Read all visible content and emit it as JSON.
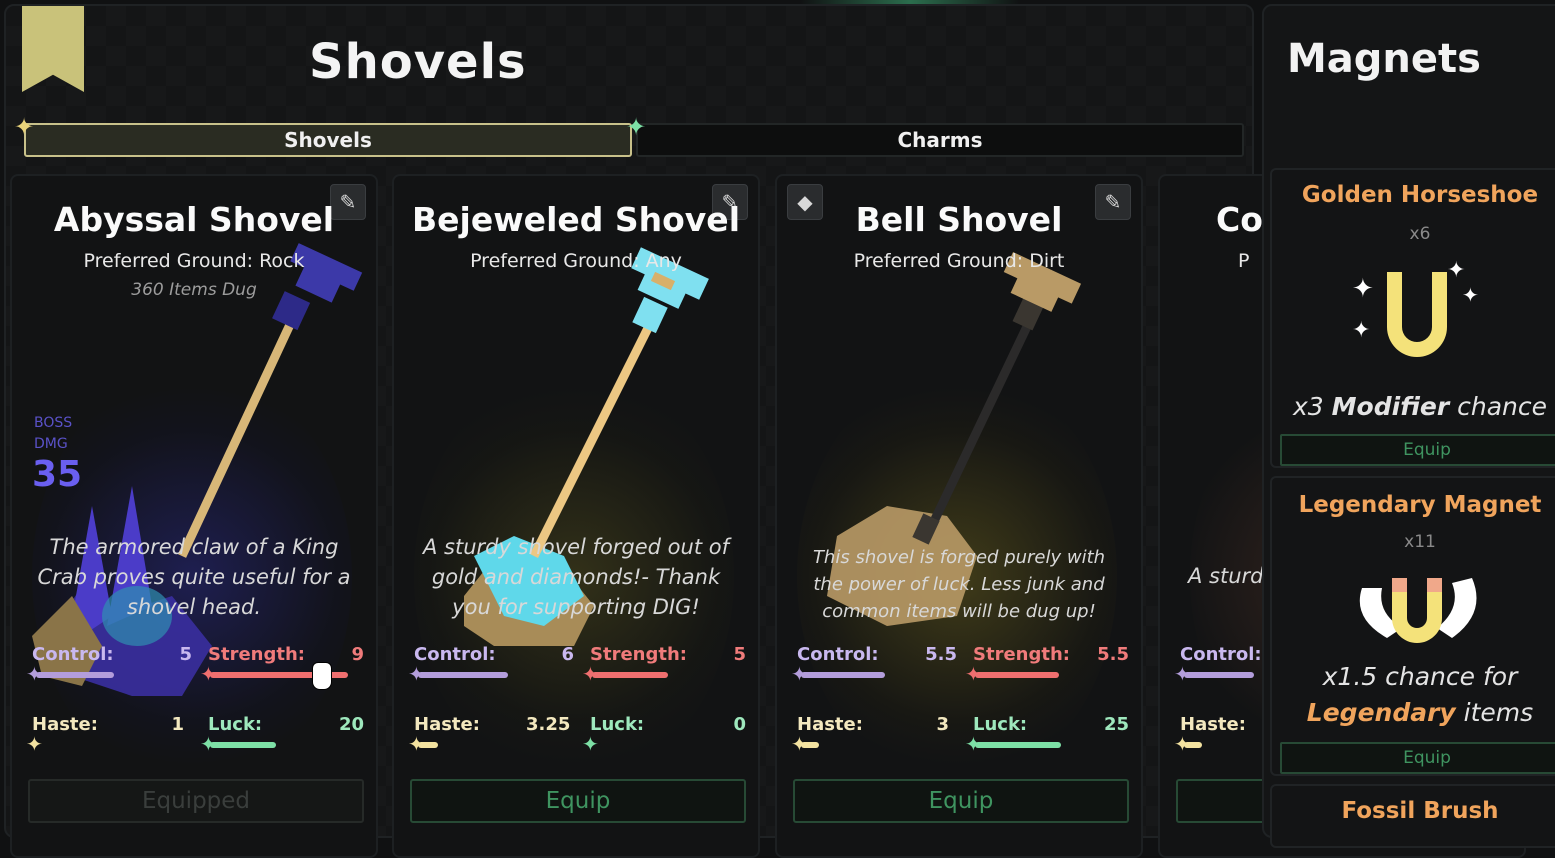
{
  "shovels_panel": {
    "title": "Shovels",
    "tabs": [
      {
        "label": "Shovels",
        "active": true
      },
      {
        "label": "Charms",
        "active": false
      }
    ]
  },
  "cards": [
    {
      "name": "Abyssal Shovel",
      "ground": "Preferred Ground: Rock",
      "items_dug": "360 Items Dug",
      "boss_label_1": "BOSS",
      "boss_label_2": "DMG",
      "boss_value": "35",
      "description": "The armored claw of a King Crab proves quite useful for a shovel head.",
      "control_label": "Control:",
      "control": "5",
      "strength_label": "Strength:",
      "strength": "9",
      "haste_label": "Haste:",
      "haste": "1",
      "luck_label": "Luck:",
      "luck": "20",
      "button": "Equipped",
      "corner_icon": "pencil-icon"
    },
    {
      "name": "Bejeweled Shovel",
      "ground": "Preferred Ground: Any",
      "description": "A sturdy shovel forged out of gold and diamonds!- Thank you for supporting DIG!",
      "control_label": "Control:",
      "control": "6",
      "strength_label": "Strength:",
      "strength": "5",
      "haste_label": "Haste:",
      "haste": "3.25",
      "luck_label": "Luck:",
      "luck": "0",
      "button": "Equip",
      "corner_icon": "pencil-icon"
    },
    {
      "name": "Bell Shovel",
      "ground": "Preferred Ground: Dirt",
      "description": "This shovel is forged purely with the power of luck. Less junk and common items will be dug up!",
      "control_label": "Control:",
      "control": "5.5",
      "strength_label": "Strength:",
      "strength": "5.5",
      "haste_label": "Haste:",
      "haste": "3",
      "luck_label": "Luck:",
      "luck": "25",
      "button": "Equip",
      "corner_icon": "pencil-icon",
      "left_icon": "gem-icon"
    },
    {
      "name": "Co",
      "ground": "P",
      "description": "A sturd",
      "control_label": "Control:",
      "haste_label": "Haste:"
    }
  ],
  "magnets_panel": {
    "title": "Magnets",
    "items": [
      {
        "name": "Golden Horseshoe",
        "count": "x6",
        "desc_pre": "x3 ",
        "desc_bold": "Modifier",
        "desc_post": " chance",
        "button": "Equip"
      },
      {
        "name": "Legendary Magnet",
        "count": "x11",
        "desc_line1": "x1.5 chance for",
        "desc_bold": "Legendary",
        "desc_post": " items",
        "button": "Equip"
      },
      {
        "name": "Fossil Brush"
      }
    ]
  },
  "colors": {
    "control": "#b39ddb",
    "strength": "#ef6f6f",
    "haste": "#f3e2a0",
    "luck": "#7de0a6",
    "accent_gold": "#c8c18a",
    "equip_green": "#3f9460"
  }
}
